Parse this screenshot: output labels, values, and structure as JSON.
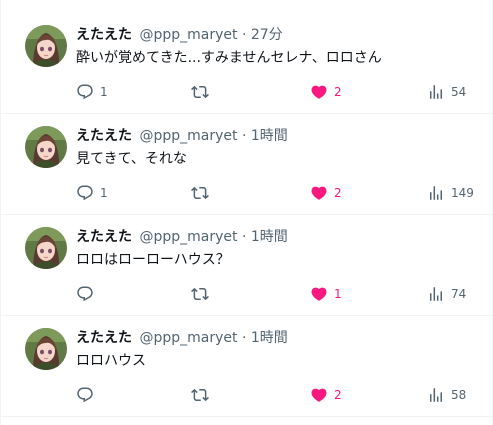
{
  "tweets": [
    {
      "display_name": "えたえた",
      "handle": "@ppp_maryet",
      "dot": "·",
      "time": "27分",
      "text": "酔いが覚めてきた...すみませんセレナ、ロロさん",
      "replies": "1",
      "retweets": "",
      "likes": "2",
      "views": "54",
      "liked": true
    },
    {
      "display_name": "えたえた",
      "handle": "@ppp_maryet",
      "dot": "·",
      "time": "1時間",
      "text": "見てきて、それな",
      "replies": "1",
      "retweets": "",
      "likes": "2",
      "views": "149",
      "liked": true
    },
    {
      "display_name": "えたえた",
      "handle": "@ppp_maryet",
      "dot": "·",
      "time": "1時間",
      "text": "ロロはローローハウス？",
      "replies": "",
      "retweets": "",
      "likes": "1",
      "views": "74",
      "liked": true
    },
    {
      "display_name": "えたえた",
      "handle": "@ppp_maryet",
      "dot": "·",
      "time": "1時間",
      "text": "ロロハウス",
      "replies": "",
      "retweets": "",
      "likes": "2",
      "views": "58",
      "liked": true
    }
  ],
  "icons": {
    "reply": "reply-icon",
    "retweet": "retweet-icon",
    "like": "heart-icon",
    "views": "views-icon"
  },
  "colors": {
    "text": "#0f1419",
    "secondary": "#536471",
    "like_active": "#f91880",
    "divider": "#eff3f4"
  }
}
